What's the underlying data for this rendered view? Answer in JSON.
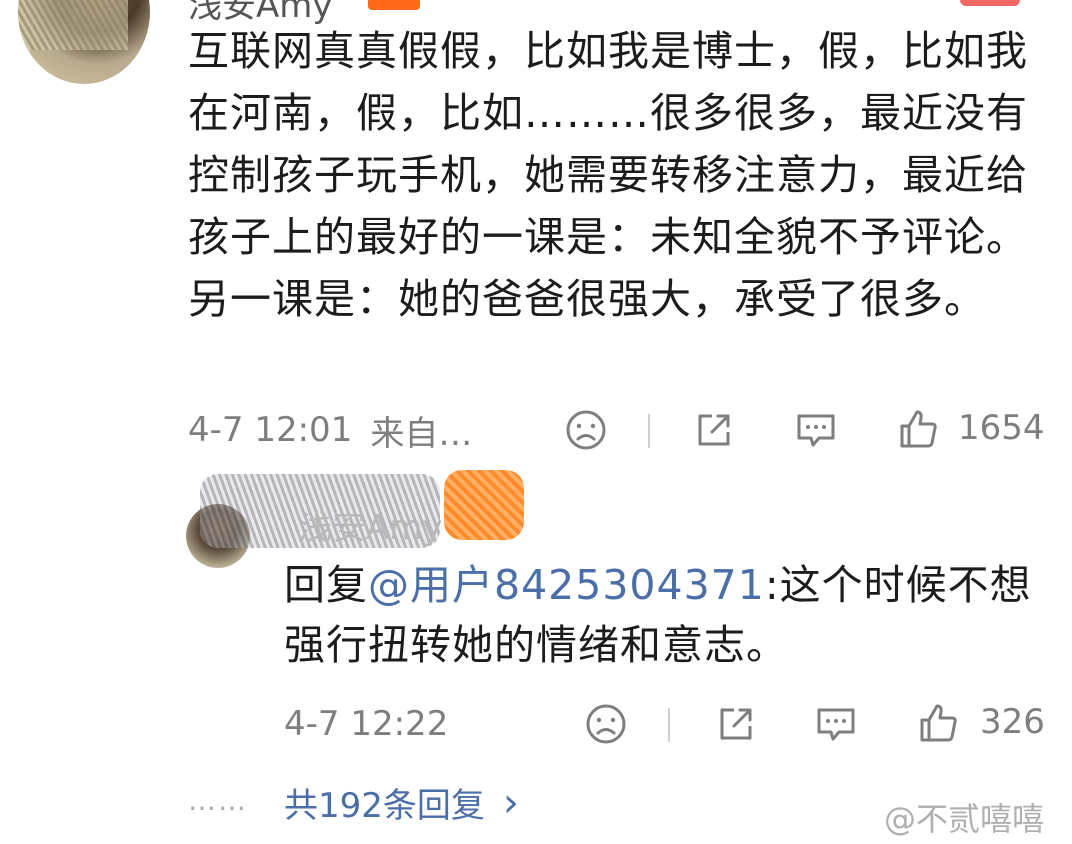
{
  "comment": {
    "author": "浅安Amy",
    "text": "互联网真真假假，比如我是博士，假，比如我在河南，假，比如………很多很多，最近没有控制孩子玩手机，她需要转移注意力，最近给孩子上的最好的一课是：未知全貌不予评论。另一课是：她的爸爸很强大，承受了很多。",
    "time": "4-7 12:01",
    "source": "来自…",
    "like_count": "1654",
    "icons": {
      "dislike": "sad-face-icon",
      "share": "share-icon",
      "comment": "comment-bubble-icon",
      "like": "thumbs-up-icon"
    }
  },
  "reply": {
    "author": "浅安Amy",
    "prefix": "回复",
    "mention": "@用户8425304371",
    "text": ":这个时候不想强行扭转她的情绪和意志。",
    "time": "4-7 12:22",
    "like_count": "326"
  },
  "footer": {
    "dots": "……",
    "more_replies": "共192条回复",
    "chevron": "›",
    "watermark": "@不贰嘻嘻"
  },
  "colors": {
    "link": "#4a6ea8",
    "meta": "#7e7e7e",
    "badge": "#ff6a1a"
  }
}
